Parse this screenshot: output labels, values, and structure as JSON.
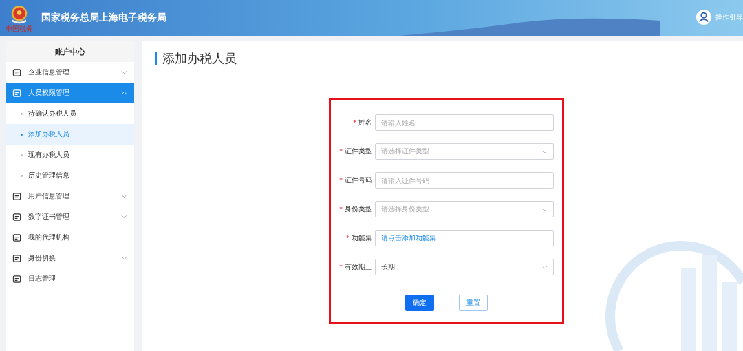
{
  "header": {
    "title": "国家税务总局上海电子税务局",
    "logo_caption": "中国税务",
    "guide_link": "操作引导"
  },
  "sidebar": {
    "title": "账户中心",
    "items": [
      {
        "label": "企业信息管理",
        "expanded": false,
        "selected": false
      },
      {
        "label": "人员权限管理",
        "expanded": true,
        "selected": true,
        "children": [
          {
            "label": "待确认办税人员",
            "selected": false
          },
          {
            "label": "添加办税人员",
            "selected": true
          },
          {
            "label": "现有办税人员",
            "selected": false
          },
          {
            "label": "历史管理信息",
            "selected": false
          }
        ]
      },
      {
        "label": "用户信息管理",
        "expanded": false,
        "selected": false
      },
      {
        "label": "数字证书管理",
        "expanded": false,
        "selected": false
      },
      {
        "label": "我的代理机构",
        "selected": false
      },
      {
        "label": "身份切换",
        "expanded": false,
        "selected": false
      },
      {
        "label": "日志管理",
        "selected": false
      }
    ]
  },
  "page": {
    "title": "添加办税人员"
  },
  "form": {
    "highlighted": true,
    "fields": [
      {
        "kind": "input",
        "required_mark": "*",
        "label": "姓名",
        "placeholder": "请输入姓名"
      },
      {
        "kind": "select",
        "required_mark": "*",
        "label": "证件类型",
        "placeholder": "请选择证件类型"
      },
      {
        "kind": "input",
        "required_mark": "*",
        "label": "证件号码",
        "placeholder": "请输入证件号码"
      },
      {
        "kind": "select",
        "required_mark": "*",
        "label": "身份类型",
        "placeholder": "请选择身份类型"
      },
      {
        "kind": "link",
        "required_mark": "*",
        "label": "功能集",
        "value": "请点击添加功能集"
      },
      {
        "kind": "select",
        "required_mark": "*",
        "label": "有效期止",
        "value": "长期"
      }
    ],
    "buttons": [
      {
        "kind": "primary",
        "label": "确定"
      },
      {
        "kind": "secondary",
        "label": "重置"
      }
    ]
  }
}
